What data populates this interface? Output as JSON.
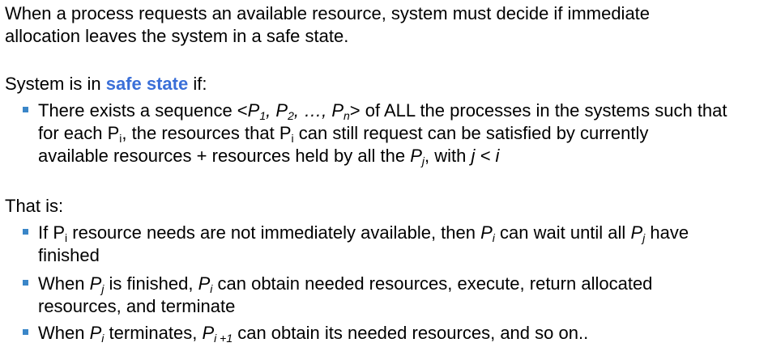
{
  "intro": {
    "line1": "When a process requests an available resource, system must decide if immediate",
    "line2": "allocation leaves the system in a safe state."
  },
  "safe_state": {
    "prefix": "System is in ",
    "highlight": "safe state",
    "suffix": " if:",
    "highlight_color": "#3a6fd8"
  },
  "definition_bullet": {
    "l1_a": "There exists a sequence <",
    "P": "P",
    "sub1": "1",
    "sep": ", ",
    "sub2": "2",
    "ellipsis": ", …, ",
    "subn": "n",
    "l1_b": "> of ALL the  processes in the systems such that",
    "l2_a": "for each P",
    "sub_i": "i",
    "l2_b": ", the resources that P",
    "l2_c": " can still request can be satisfied by currently",
    "l3_a": "available resources + resources held by all the ",
    "sub_j": "j",
    "l3_b": ", with ",
    "l3_cond": "j < i"
  },
  "that_is": "That is:",
  "bullet_color": "#3a86c8",
  "bullets": [
    {
      "l1_a": "If P",
      "sub_a": "i",
      "l1_b": " resource needs are not immediately available, then ",
      "P": "P",
      "sub_b": "i",
      "l1_c": " can wait until all ",
      "sub_c": "j",
      "l1_d": " have",
      "l2": "finished"
    },
    {
      "l1_a": "When ",
      "P": "P",
      "sub_a": "j",
      "l1_b": " is finished, ",
      "sub_b": "i",
      "l1_c": " can obtain needed resources, execute, return allocated",
      "l2": "resources, and terminate"
    },
    {
      "l1_a": "When ",
      "P": "P",
      "sub_a": "i",
      "l1_b": " terminates, ",
      "sub_b": "i +1",
      "l1_c": " can obtain its needed resources, and so on.."
    }
  ]
}
